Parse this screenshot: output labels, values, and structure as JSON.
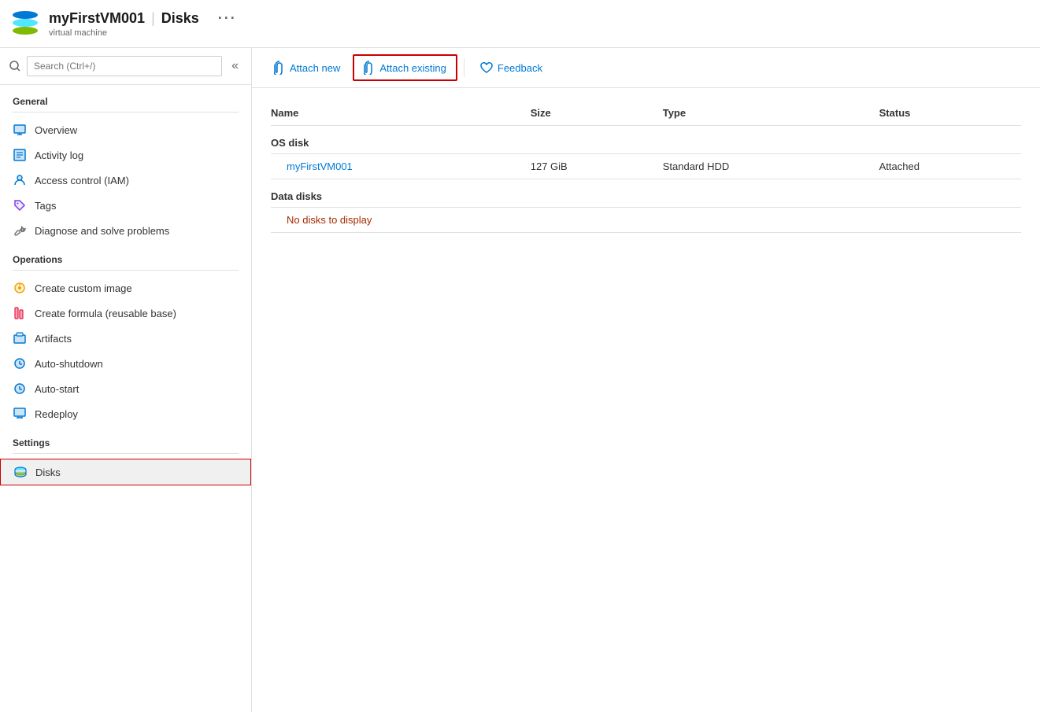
{
  "header": {
    "vm_name": "myFirstVM001",
    "separator": "|",
    "page_title": "Disks",
    "more_icon": "···",
    "subtitle": "virtual machine"
  },
  "search": {
    "placeholder": "Search (Ctrl+/)"
  },
  "collapse_btn": "«",
  "sidebar": {
    "sections": [
      {
        "label": "General",
        "items": [
          {
            "id": "overview",
            "label": "Overview",
            "icon": "monitor"
          },
          {
            "id": "activity-log",
            "label": "Activity log",
            "icon": "list"
          },
          {
            "id": "iam",
            "label": "Access control (IAM)",
            "icon": "person"
          },
          {
            "id": "tags",
            "label": "Tags",
            "icon": "tag"
          },
          {
            "id": "diagnose",
            "label": "Diagnose and solve problems",
            "icon": "wrench"
          }
        ]
      },
      {
        "label": "Operations",
        "items": [
          {
            "id": "custom-image",
            "label": "Create custom image",
            "icon": "image"
          },
          {
            "id": "formula",
            "label": "Create formula (reusable base)",
            "icon": "formula"
          },
          {
            "id": "artifacts",
            "label": "Artifacts",
            "icon": "artifacts"
          },
          {
            "id": "auto-shutdown",
            "label": "Auto-shutdown",
            "icon": "clock"
          },
          {
            "id": "auto-start",
            "label": "Auto-start",
            "icon": "clock"
          },
          {
            "id": "redeploy",
            "label": "Redeploy",
            "icon": "redeploy"
          }
        ]
      },
      {
        "label": "Settings",
        "items": [
          {
            "id": "disks",
            "label": "Disks",
            "icon": "disk",
            "active": true
          }
        ]
      }
    ]
  },
  "toolbar": {
    "attach_new_label": "Attach new",
    "attach_existing_label": "Attach existing",
    "feedback_label": "Feedback"
  },
  "table": {
    "headers": [
      "Name",
      "Size",
      "Type",
      "Status"
    ],
    "os_disk_section": "OS disk",
    "os_disk_row": {
      "name": "myFirstVM001",
      "size": "127 GiB",
      "type": "Standard HDD",
      "status": "Attached"
    },
    "data_disk_section": "Data disks",
    "no_disks_msg": "No disks to display"
  },
  "colors": {
    "accent_blue": "#0078d4",
    "active_border": "#c00000",
    "link_color": "#0078d4",
    "no_disks_color": "#a52a00"
  }
}
